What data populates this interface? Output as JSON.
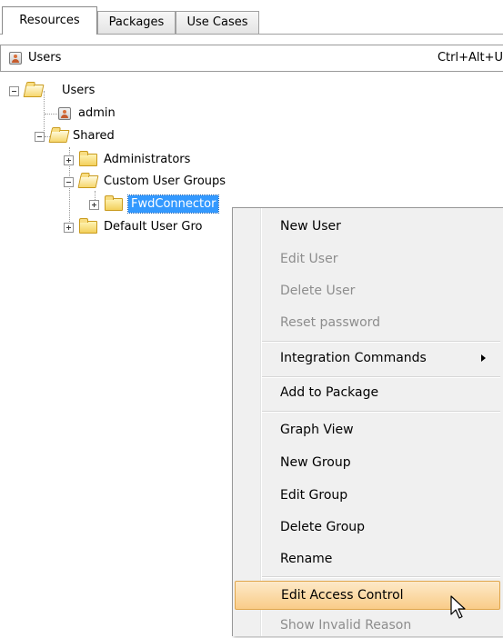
{
  "tabs": [
    {
      "label": "Resources",
      "active": true
    },
    {
      "label": "Packages",
      "active": false
    },
    {
      "label": "Use Cases",
      "active": false
    }
  ],
  "toolbar": {
    "title": "Users",
    "shortcut": "Ctrl+Alt+U",
    "icon": "user-icon"
  },
  "tree": {
    "root": "Users",
    "admin": "admin",
    "shared": "Shared",
    "administrators": "Administrators",
    "custom_user_groups": "Custom User Groups",
    "fwd_connector": "FwdConnector",
    "default_user_groups": "Default User Gro"
  },
  "context_menu": {
    "items": [
      {
        "label": "New User",
        "enabled": true
      },
      {
        "label": "Edit User",
        "enabled": false
      },
      {
        "label": "Delete User",
        "enabled": false
      },
      {
        "label": "Reset password",
        "enabled": false
      },
      {
        "label": "Integration Commands",
        "enabled": true,
        "submenu": true
      },
      {
        "label": "Add to Package",
        "enabled": true
      },
      {
        "label": "Graph View",
        "enabled": true
      },
      {
        "label": "New Group",
        "enabled": true
      },
      {
        "label": "Edit Group",
        "enabled": true
      },
      {
        "label": "Delete Group",
        "enabled": true
      },
      {
        "label": "Rename",
        "enabled": true
      },
      {
        "label": "Edit Access Control",
        "enabled": true,
        "highlighted": true
      },
      {
        "label": "Show Invalid Reason",
        "enabled": false
      }
    ]
  },
  "colors": {
    "selection": "#3399ff",
    "menu_highlight": "#f9cc88",
    "disabled_text": "#8d8d8d"
  }
}
